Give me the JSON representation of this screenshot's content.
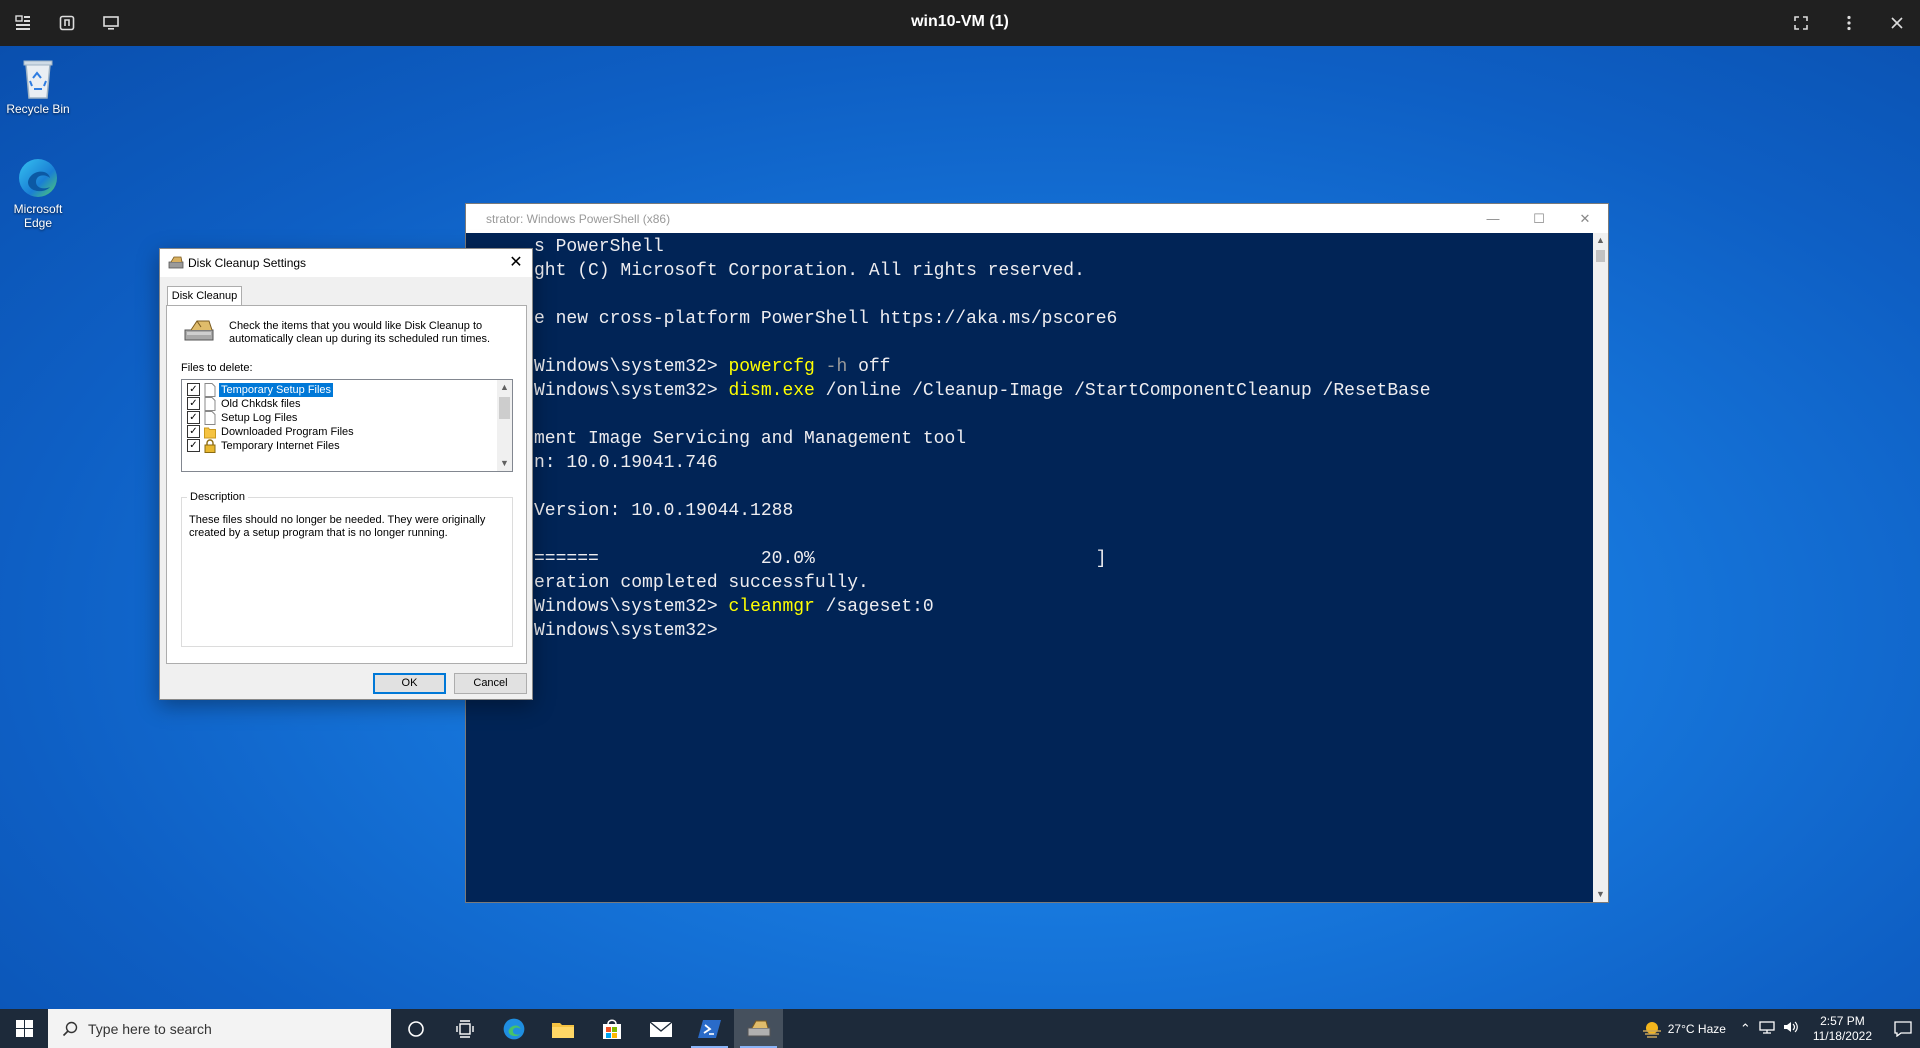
{
  "vm": {
    "title": "win10-VM (1)"
  },
  "desktop": {
    "icons": [
      {
        "label": "Recycle Bin"
      },
      {
        "label": "Microsoft Edge"
      }
    ]
  },
  "powershell": {
    "title": "strator: Windows PowerShell (x86)",
    "lines": [
      {
        "text": "s PowerShell"
      },
      {
        "text": "ght (C) Microsoft Corporation. All rights reserved."
      },
      {
        "text": ""
      },
      {
        "text": "e new cross-platform PowerShell https://aka.ms/pscore6"
      },
      {
        "text": ""
      },
      {
        "prompt": "Windows\\system32> ",
        "cmd": "powercfg",
        "param": " -h",
        "rest": " off"
      },
      {
        "prompt": "Windows\\system32> ",
        "cmd": "dism.exe",
        "param": "",
        "rest": " /online /Cleanup-Image /StartComponentCleanup /ResetBase"
      },
      {
        "text": ""
      },
      {
        "text": "ment Image Servicing and Management tool"
      },
      {
        "text": "n: 10.0.19041.746"
      },
      {
        "text": ""
      },
      {
        "text": "Version: 10.0.19044.1288"
      },
      {
        "text": ""
      },
      {
        "text": "======               20.0%                          ]"
      },
      {
        "text": "eration completed successfully."
      },
      {
        "prompt": "Windows\\system32> ",
        "cmd": "cleanmgr",
        "param": "",
        "rest": " /sageset:0"
      },
      {
        "text": "Windows\\system32>"
      }
    ]
  },
  "dialog": {
    "title": "Disk Cleanup Settings",
    "tab": "Disk Cleanup",
    "intro": "Check the items that you would like Disk Cleanup to automatically clean up during its scheduled run times.",
    "files_label": "Files to delete:",
    "files": [
      {
        "label": "Temporary Setup Files",
        "checked": true,
        "selected": true,
        "icon": "blank-file-icon"
      },
      {
        "label": "Old Chkdsk files",
        "checked": true,
        "selected": false,
        "icon": "blank-file-icon"
      },
      {
        "label": "Setup Log Files",
        "checked": true,
        "selected": false,
        "icon": "blank-file-icon"
      },
      {
        "label": "Downloaded Program Files",
        "checked": true,
        "selected": false,
        "icon": "folder-icon"
      },
      {
        "label": "Temporary Internet Files",
        "checked": true,
        "selected": false,
        "icon": "lock-icon"
      }
    ],
    "description_label": "Description",
    "description": "These files should no longer be needed. They were originally created by a setup program that is no longer running.",
    "ok": "OK",
    "cancel": "Cancel"
  },
  "taskbar": {
    "search_placeholder": "Type here to search",
    "weather": "27°C  Haze",
    "time": "2:57 PM",
    "date": "11/18/2022",
    "apps": [
      "cortana-icon",
      "task-view-icon",
      "edge-icon",
      "file-explorer-icon",
      "store-icon",
      "mail-icon",
      "powershell-icon",
      "disk-cleanup-icon"
    ]
  },
  "colors": {
    "ps_background": "#012456",
    "ps_command": "#ffff00",
    "selection": "#0078d7"
  }
}
